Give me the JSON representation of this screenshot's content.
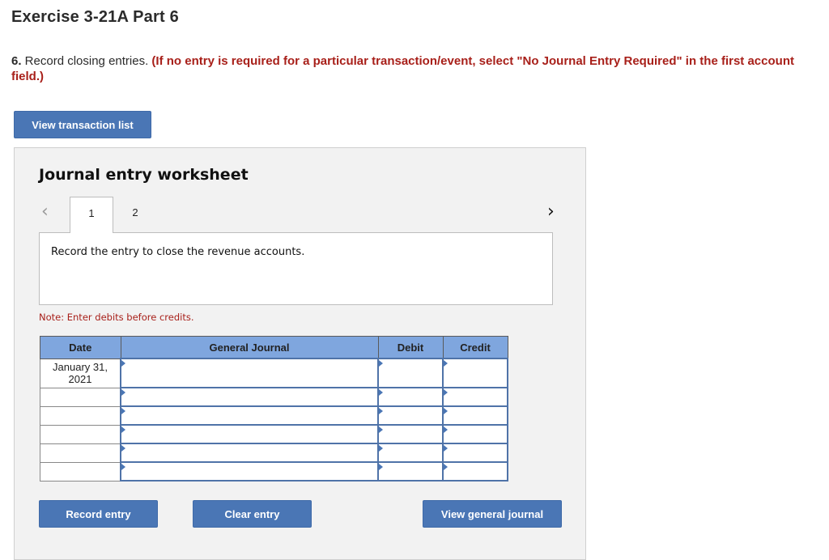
{
  "page": {
    "title": "Exercise 3-21A Part 6",
    "instruction": {
      "number": "6.",
      "text": " Record closing entries. ",
      "emphasis": "(If no entry is required for a particular transaction/event, select \"No Journal Entry Required\" in the first account field.)"
    }
  },
  "buttons": {
    "view_transaction_list": "View transaction list",
    "record_entry": "Record entry",
    "clear_entry": "Clear entry",
    "view_general_journal": "View general journal"
  },
  "worksheet": {
    "title": "Journal entry worksheet",
    "nav_prev_icon": "‹",
    "nav_next_icon": "›",
    "tabs": [
      {
        "label": "1",
        "active": true
      },
      {
        "label": "2",
        "active": false
      }
    ],
    "description": "Record the entry to close the revenue accounts.",
    "note": "Note: Enter debits before credits."
  },
  "journal_table": {
    "headers": {
      "date": "Date",
      "general_journal": "General Journal",
      "debit": "Debit",
      "credit": "Credit"
    },
    "rows": [
      {
        "date": "January 31, 2021",
        "account": "",
        "debit": "",
        "credit": ""
      },
      {
        "date": "",
        "account": "",
        "debit": "",
        "credit": ""
      },
      {
        "date": "",
        "account": "",
        "debit": "",
        "credit": ""
      },
      {
        "date": "",
        "account": "",
        "debit": "",
        "credit": ""
      },
      {
        "date": "",
        "account": "",
        "debit": "",
        "credit": ""
      },
      {
        "date": "",
        "account": "",
        "debit": "",
        "credit": ""
      }
    ]
  },
  "colors": {
    "button_blue": "#4a76b5",
    "header_blue": "#7fa6de",
    "emphasis_red": "#a8201a",
    "panel_bg": "#f2f2f2"
  }
}
